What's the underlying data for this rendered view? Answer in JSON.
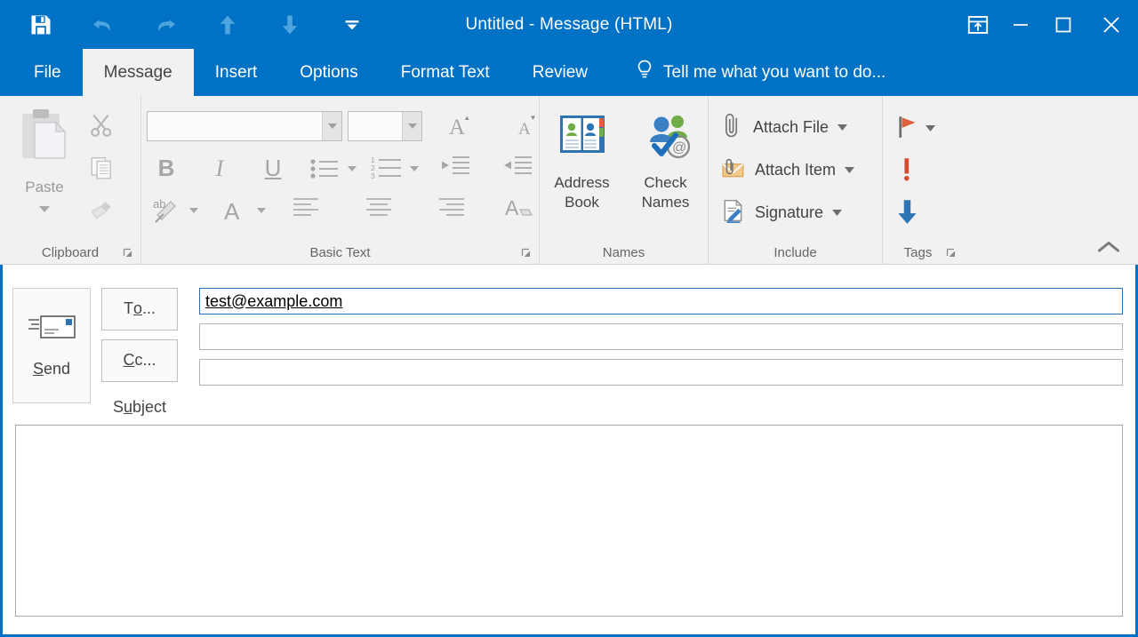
{
  "window": {
    "title": "Untitled - Message (HTML)",
    "accent_color": "#0072c6",
    "ribbon_bg": "#f1f1f1",
    "controls": {
      "ribbon_display_options": "Ribbon Display Options",
      "minimize": "Minimize",
      "maximize": "Maximize",
      "close": "Close"
    }
  },
  "quick_access": {
    "items": [
      {
        "name": "save-icon",
        "label": "Save"
      },
      {
        "name": "undo-icon",
        "label": "Undo"
      },
      {
        "name": "redo-icon",
        "label": "Redo"
      },
      {
        "name": "previous-item-icon",
        "label": "Previous Item"
      },
      {
        "name": "next-item-icon",
        "label": "Next Item"
      },
      {
        "name": "customize-quick-access-toolbar-icon",
        "label": "Customize Quick Access Toolbar"
      }
    ]
  },
  "tabs": [
    {
      "label": "File",
      "active": false
    },
    {
      "label": "Message",
      "active": true
    },
    {
      "label": "Insert",
      "active": false
    },
    {
      "label": "Options",
      "active": false
    },
    {
      "label": "Format Text",
      "active": false
    },
    {
      "label": "Review",
      "active": false
    }
  ],
  "tell_me": {
    "label": "Tell me what you want to do...",
    "icon": "lightbulb-icon"
  },
  "ribbon": {
    "groups": [
      {
        "name": "clipboard",
        "label": "Clipboard",
        "has_dialog_launcher": true,
        "paste": {
          "label": "Paste",
          "enabled": false
        },
        "commands": [
          {
            "label": "Cut",
            "icon": "scissors-icon",
            "enabled": false
          },
          {
            "label": "Copy",
            "icon": "copy-icon",
            "enabled": false
          },
          {
            "label": "Format Painter",
            "icon": "paintbrush-icon",
            "enabled": false
          }
        ]
      },
      {
        "name": "basic-text",
        "label": "Basic Text",
        "has_dialog_launcher": true,
        "font_name": {
          "value": "",
          "placeholder": ""
        },
        "font_size": {
          "value": "",
          "placeholder": ""
        },
        "commands": [
          {
            "label": "Grow Font",
            "icon": "grow-font-icon",
            "enabled": false
          },
          {
            "label": "Shrink Font",
            "icon": "shrink-font-icon",
            "enabled": false
          },
          {
            "label": "Bold",
            "icon": "bold-icon",
            "enabled": false
          },
          {
            "label": "Italic",
            "icon": "italic-icon",
            "enabled": false
          },
          {
            "label": "Underline",
            "icon": "underline-icon",
            "enabled": false
          },
          {
            "label": "Bullets",
            "icon": "bullet-list-icon",
            "enabled": false
          },
          {
            "label": "Numbering",
            "icon": "numbered-list-icon",
            "enabled": false
          },
          {
            "label": "Decrease Indent",
            "icon": "decrease-indent-icon",
            "enabled": false
          },
          {
            "label": "Increase Indent",
            "icon": "increase-indent-icon",
            "enabled": false
          },
          {
            "label": "Text Highlight Color",
            "icon": "highlight-icon",
            "enabled": false
          },
          {
            "label": "Font Color",
            "icon": "font-color-icon",
            "enabled": false
          },
          {
            "label": "Align Left",
            "icon": "align-left-icon",
            "enabled": false
          },
          {
            "label": "Center",
            "icon": "align-center-icon",
            "enabled": false
          },
          {
            "label": "Align Right",
            "icon": "align-right-icon",
            "enabled": false
          },
          {
            "label": "Clear All Formatting",
            "icon": "clear-formatting-icon",
            "enabled": false
          }
        ]
      },
      {
        "name": "names",
        "label": "Names",
        "has_dialog_launcher": false,
        "buttons": [
          {
            "label_line1": "Address",
            "label_line2": "Book",
            "icon": "address-book-icon"
          },
          {
            "label_line1": "Check",
            "label_line2": "Names",
            "icon": "check-names-icon"
          }
        ]
      },
      {
        "name": "include",
        "label": "Include",
        "has_dialog_launcher": false,
        "items": [
          {
            "label": "Attach File",
            "icon": "paperclip-icon",
            "has_dropdown": true
          },
          {
            "label": "Attach Item",
            "icon": "attach-item-icon",
            "has_dropdown": true
          },
          {
            "label": "Signature",
            "icon": "signature-icon",
            "has_dropdown": true
          }
        ]
      },
      {
        "name": "tags",
        "label": "Tags",
        "has_dialog_launcher": true,
        "items": [
          {
            "label": "Follow Up",
            "icon": "flag-icon",
            "color": "#e0603c",
            "has_dropdown": true
          },
          {
            "label": "High Importance",
            "icon": "exclamation-icon",
            "color": "#d64a2a",
            "has_dropdown": false
          },
          {
            "label": "Low Importance",
            "icon": "down-arrow-icon",
            "color": "#2e74b5",
            "has_dropdown": false
          }
        ]
      }
    ],
    "collapse_label": "Collapse the Ribbon"
  },
  "compose": {
    "send_button": {
      "label": "Send",
      "accesskey": "S",
      "icon": "send-envelope-icon"
    },
    "to_button": {
      "label": "To...",
      "accesskey": "o"
    },
    "cc_button": {
      "label": "Cc...",
      "accesskey": "C"
    },
    "subject_label": {
      "label": "Subject",
      "accesskey": "u"
    },
    "to_field": {
      "value": "test@example.com",
      "placeholder": "",
      "focused": true
    },
    "cc_field": {
      "value": "",
      "placeholder": "",
      "focused": false
    },
    "subject_field": {
      "value": "",
      "placeholder": "",
      "focused": false
    },
    "body": {
      "value": "",
      "placeholder": ""
    }
  }
}
